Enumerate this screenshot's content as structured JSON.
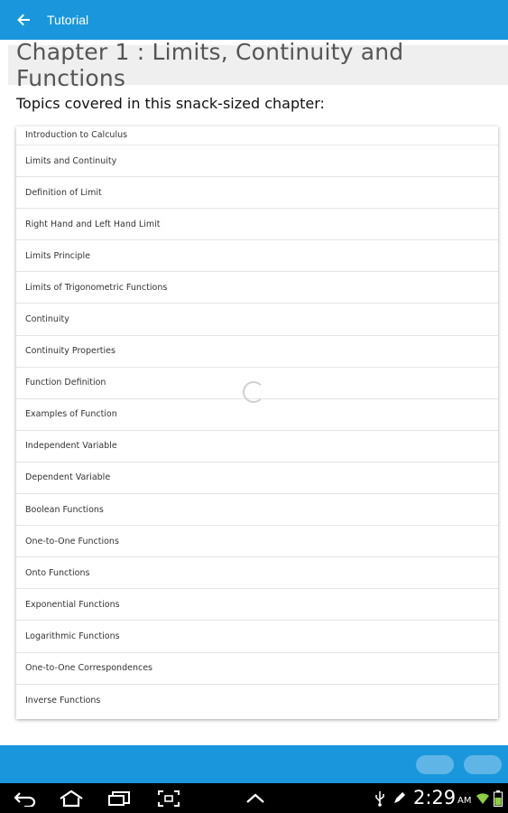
{
  "app_bar": {
    "title": "Tutorial"
  },
  "chapter": {
    "title": "Chapter 1 : Limits, Continuity and Functions",
    "topics_heading": "Topics covered in this snack-sized chapter:",
    "topics": [
      "Introduction to Calculus",
      "Limits and Continuity",
      "Definition of Limit",
      "Right Hand and Left Hand Limit",
      "Limits Principle",
      "Limits of Trigonometric Functions",
      "Continuity",
      "Continuity Properties",
      "Function Definition",
      "Examples of Function",
      "Independent Variable",
      "Dependent Variable",
      "Boolean Functions",
      "One-to-One Functions",
      "Onto Functions",
      "Exponential Functions",
      "Logarithmic Functions",
      "One-to-One Correspondences",
      "Inverse Functions"
    ]
  },
  "status_bar": {
    "time": "2:29",
    "ampm": "AM"
  },
  "colors": {
    "primary": "#1a97dc",
    "pill": "#5fb6e6",
    "title_bg": "#efefef"
  },
  "icons": {
    "app_bar": [
      "back-arrow-icon"
    ],
    "nav": [
      "back-icon",
      "home-icon",
      "recent-apps-icon",
      "screenshot-icon",
      "up-chevron-icon"
    ],
    "status": [
      "usb-icon",
      "pencil-icon",
      "wifi-icon",
      "battery-icon"
    ]
  }
}
